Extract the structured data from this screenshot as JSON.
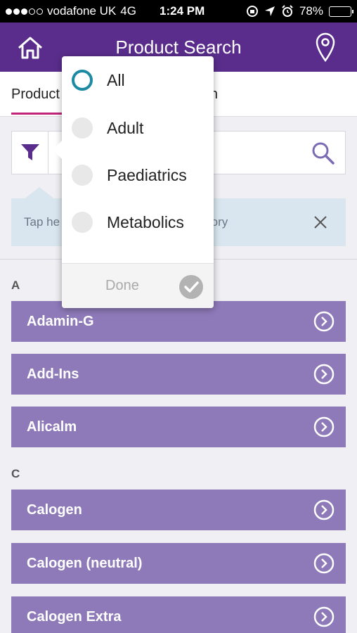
{
  "status_bar": {
    "carrier": "vodafone UK",
    "network": "4G",
    "time": "1:24 PM",
    "battery": "78%",
    "battery_level": 0.78,
    "signal_bars": 3
  },
  "header": {
    "title": "Product Search",
    "left_icon": "home-icon",
    "right_icon": "location-pin-icon"
  },
  "tabs": [
    {
      "label": "Product",
      "selected": true
    },
    {
      "label": "earch",
      "selected": false
    }
  ],
  "search": {
    "filter_icon": "filter-icon",
    "search_icon": "search-icon"
  },
  "hint": {
    "text_left": "Tap he",
    "text_right": "category",
    "close_icon": "close-icon"
  },
  "filter_popover": {
    "options": [
      {
        "label": "All",
        "selected": true
      },
      {
        "label": "Adult",
        "selected": false
      },
      {
        "label": "Paediatrics",
        "selected": false
      },
      {
        "label": "Metabolics",
        "selected": false
      }
    ],
    "done_label": "Done"
  },
  "sections": [
    {
      "letter": "A",
      "items": [
        {
          "label": "Adamin-G"
        },
        {
          "label": "Add-Ins"
        },
        {
          "label": "Alicalm"
        }
      ]
    },
    {
      "letter": "C",
      "items": [
        {
          "label": "Calogen"
        },
        {
          "label": "Calogen (neutral)"
        },
        {
          "label": "Calogen Extra"
        }
      ]
    }
  ],
  "colors": {
    "header": "#5a2d8c",
    "item": "#8e7ab9",
    "tab_underline": "#c0257a",
    "hint_bg": "#dae6ef",
    "radio_selected": "#1d8aa3"
  }
}
